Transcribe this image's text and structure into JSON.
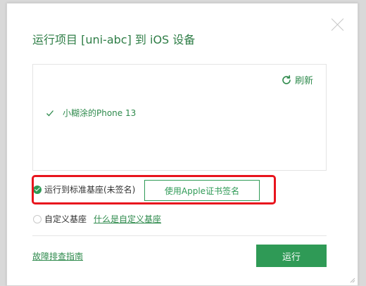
{
  "dialog": {
    "title": "运行项目 [uni-abc] 到 iOS 设备",
    "refresh_label": "刷新",
    "device": {
      "name": "小糊涂的Phone 13",
      "selected": true
    },
    "options": [
      {
        "label": "运行到标准基座(未签名)",
        "checked": true
      },
      {
        "label": "自定义基座",
        "checked": false
      }
    ],
    "apple_sign_button": "使用Apple证书签名",
    "custom_base_help_link": "什么是自定义基座",
    "troubleshoot_link": "故障排查指南",
    "run_button": "运行"
  },
  "colors": {
    "accent": "#2f9a56",
    "highlight": "#e8141d",
    "title": "#2e7d46"
  }
}
